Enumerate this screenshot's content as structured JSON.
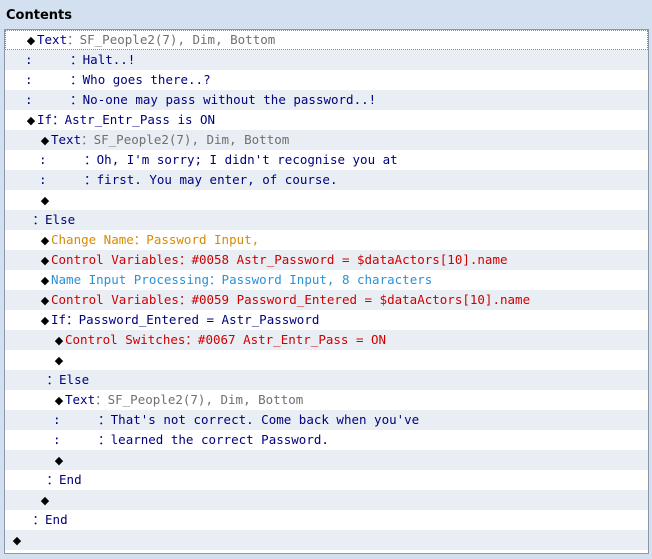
{
  "window": {
    "title": "Contents"
  },
  "colors": {
    "gray": "#707070",
    "navy": "#000080",
    "red": "#d00000",
    "orange": "#d88a00",
    "cyan": "#2a92d6"
  },
  "rows": [
    {
      "indent": 1,
      "marker": "diamond",
      "segments": [
        {
          "text": "Text",
          "color": "navy"
        },
        {
          "text": "：SF_People2(7), Dim, Bottom",
          "color": "gray"
        }
      ]
    },
    {
      "indent": 1,
      "marker": "none",
      "segments": [
        {
          "text": ":     ：",
          "color": "navy"
        },
        {
          "text": "Halt..!",
          "color": "navy"
        }
      ]
    },
    {
      "indent": 1,
      "marker": "none",
      "segments": [
        {
          "text": ":     ：",
          "color": "navy"
        },
        {
          "text": "Who goes there..?",
          "color": "navy"
        }
      ]
    },
    {
      "indent": 1,
      "marker": "none",
      "segments": [
        {
          "text": ":     ：",
          "color": "navy"
        },
        {
          "text": "No-one may pass without the password..!",
          "color": "navy"
        }
      ]
    },
    {
      "indent": 1,
      "marker": "diamond",
      "segments": [
        {
          "text": "If",
          "color": "navy"
        },
        {
          "text": "：Astr_Entr_Pass is ON",
          "color": "navy"
        }
      ]
    },
    {
      "indent": 2,
      "marker": "diamond",
      "segments": [
        {
          "text": "Text",
          "color": "navy"
        },
        {
          "text": "：SF_People2(7), Dim, Bottom",
          "color": "gray"
        }
      ]
    },
    {
      "indent": 2,
      "marker": "none",
      "segments": [
        {
          "text": ":     ：",
          "color": "navy"
        },
        {
          "text": "Oh, I'm sorry; I didn't recognise you at",
          "color": "navy"
        }
      ]
    },
    {
      "indent": 2,
      "marker": "none",
      "segments": [
        {
          "text": ":     ：",
          "color": "navy"
        },
        {
          "text": "first. You may enter, of course.",
          "color": "navy"
        }
      ]
    },
    {
      "indent": 2,
      "marker": "diamond",
      "segments": []
    },
    {
      "indent": 1,
      "marker": "none",
      "segments": [
        {
          "text": " ：Else",
          "color": "navy"
        }
      ]
    },
    {
      "indent": 2,
      "marker": "diamond",
      "segments": [
        {
          "text": "Change Name",
          "color": "orange"
        },
        {
          "text": "：Password Input,",
          "color": "orange"
        }
      ]
    },
    {
      "indent": 2,
      "marker": "diamond",
      "segments": [
        {
          "text": "Control Variables",
          "color": "red"
        },
        {
          "text": "：#0058 Astr_Password = $dataActors[10].name",
          "color": "red"
        }
      ]
    },
    {
      "indent": 2,
      "marker": "diamond",
      "segments": [
        {
          "text": "Name Input Processing",
          "color": "cyan"
        },
        {
          "text": "：Password Input, 8 characters",
          "color": "cyan"
        }
      ]
    },
    {
      "indent": 2,
      "marker": "diamond",
      "segments": [
        {
          "text": "Control Variables",
          "color": "red"
        },
        {
          "text": "：#0059 Password_Entered = $dataActors[10].name",
          "color": "red"
        }
      ]
    },
    {
      "indent": 2,
      "marker": "diamond",
      "segments": [
        {
          "text": "If",
          "color": "navy"
        },
        {
          "text": "：Password_Entered = Astr_Password",
          "color": "navy"
        }
      ]
    },
    {
      "indent": 3,
      "marker": "diamond",
      "segments": [
        {
          "text": "Control Switches",
          "color": "red"
        },
        {
          "text": "：#0067 Astr_Entr_Pass = ON",
          "color": "red"
        }
      ]
    },
    {
      "indent": 3,
      "marker": "diamond",
      "segments": []
    },
    {
      "indent": 2,
      "marker": "none",
      "segments": [
        {
          "text": " ：Else",
          "color": "navy"
        }
      ]
    },
    {
      "indent": 3,
      "marker": "diamond",
      "segments": [
        {
          "text": "Text",
          "color": "navy"
        },
        {
          "text": "：SF_People2(7), Dim, Bottom",
          "color": "gray"
        }
      ]
    },
    {
      "indent": 3,
      "marker": "none",
      "segments": [
        {
          "text": ":     ：",
          "color": "navy"
        },
        {
          "text": "That's not correct. Come back when you've",
          "color": "navy"
        }
      ]
    },
    {
      "indent": 3,
      "marker": "none",
      "segments": [
        {
          "text": ":     ：",
          "color": "navy"
        },
        {
          "text": "learned the correct Password.",
          "color": "navy"
        }
      ]
    },
    {
      "indent": 3,
      "marker": "diamond",
      "segments": []
    },
    {
      "indent": 2,
      "marker": "none",
      "segments": [
        {
          "text": " ：End",
          "color": "navy"
        }
      ]
    },
    {
      "indent": 2,
      "marker": "diamond",
      "segments": []
    },
    {
      "indent": 1,
      "marker": "none",
      "segments": [
        {
          "text": " ：End",
          "color": "navy"
        }
      ]
    },
    {
      "indent": 0,
      "marker": "diamond",
      "segments": []
    }
  ]
}
